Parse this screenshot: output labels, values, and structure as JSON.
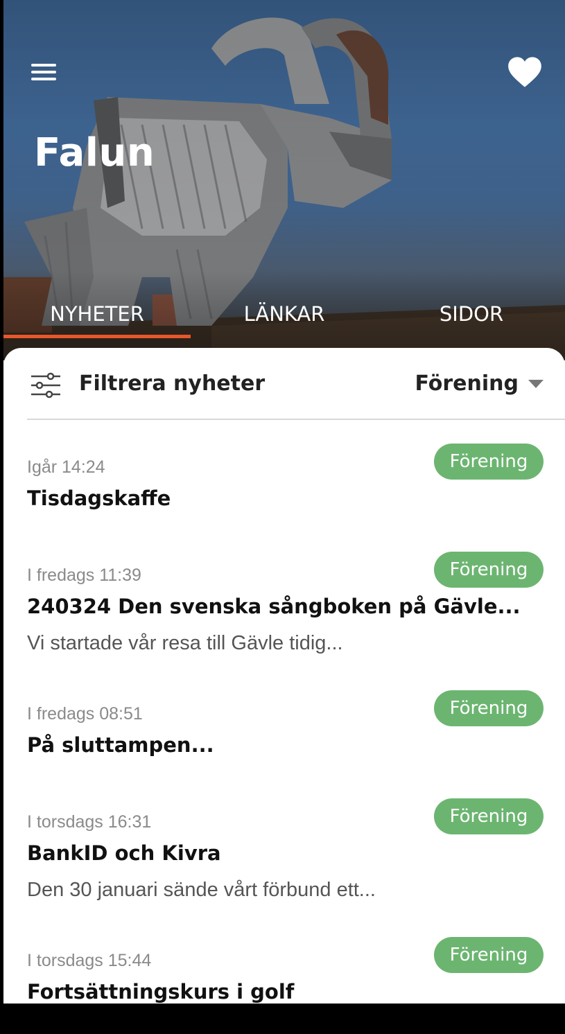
{
  "header": {
    "title": "Falun",
    "menu_icon": "hamburger-menu-icon",
    "favorite_icon": "heart-icon"
  },
  "tabs": [
    {
      "label": "NYHETER",
      "active": true
    },
    {
      "label": "LÄNKAR",
      "active": false
    },
    {
      "label": "SIDOR",
      "active": false
    }
  ],
  "filter": {
    "label": "Filtrera nyheter",
    "selected": "Förening",
    "icon": "sliders-icon"
  },
  "news": [
    {
      "time": "Igår 14:24",
      "badge": "Förening",
      "title": "Tisdagskaffe",
      "excerpt": ""
    },
    {
      "time": "I fredags 11:39",
      "badge": "Förening",
      "title": "240324 Den svenska sångboken på Gävle...",
      "excerpt": "Vi startade vår resa till Gävle tidig..."
    },
    {
      "time": "I fredags 08:51",
      "badge": "Förening",
      "title": "På sluttampen...",
      "excerpt": ""
    },
    {
      "time": "I torsdags 16:31",
      "badge": "Förening",
      "title": "BankID och Kivra",
      "excerpt": "Den 30 januari sände vårt förbund ett..."
    },
    {
      "time": "I torsdags 15:44",
      "badge": "Förening",
      "title": "Fortsättningskurs i golf",
      "excerpt": ""
    }
  ],
  "colors": {
    "accent": "#e8572a",
    "badge": "#6cb571"
  }
}
